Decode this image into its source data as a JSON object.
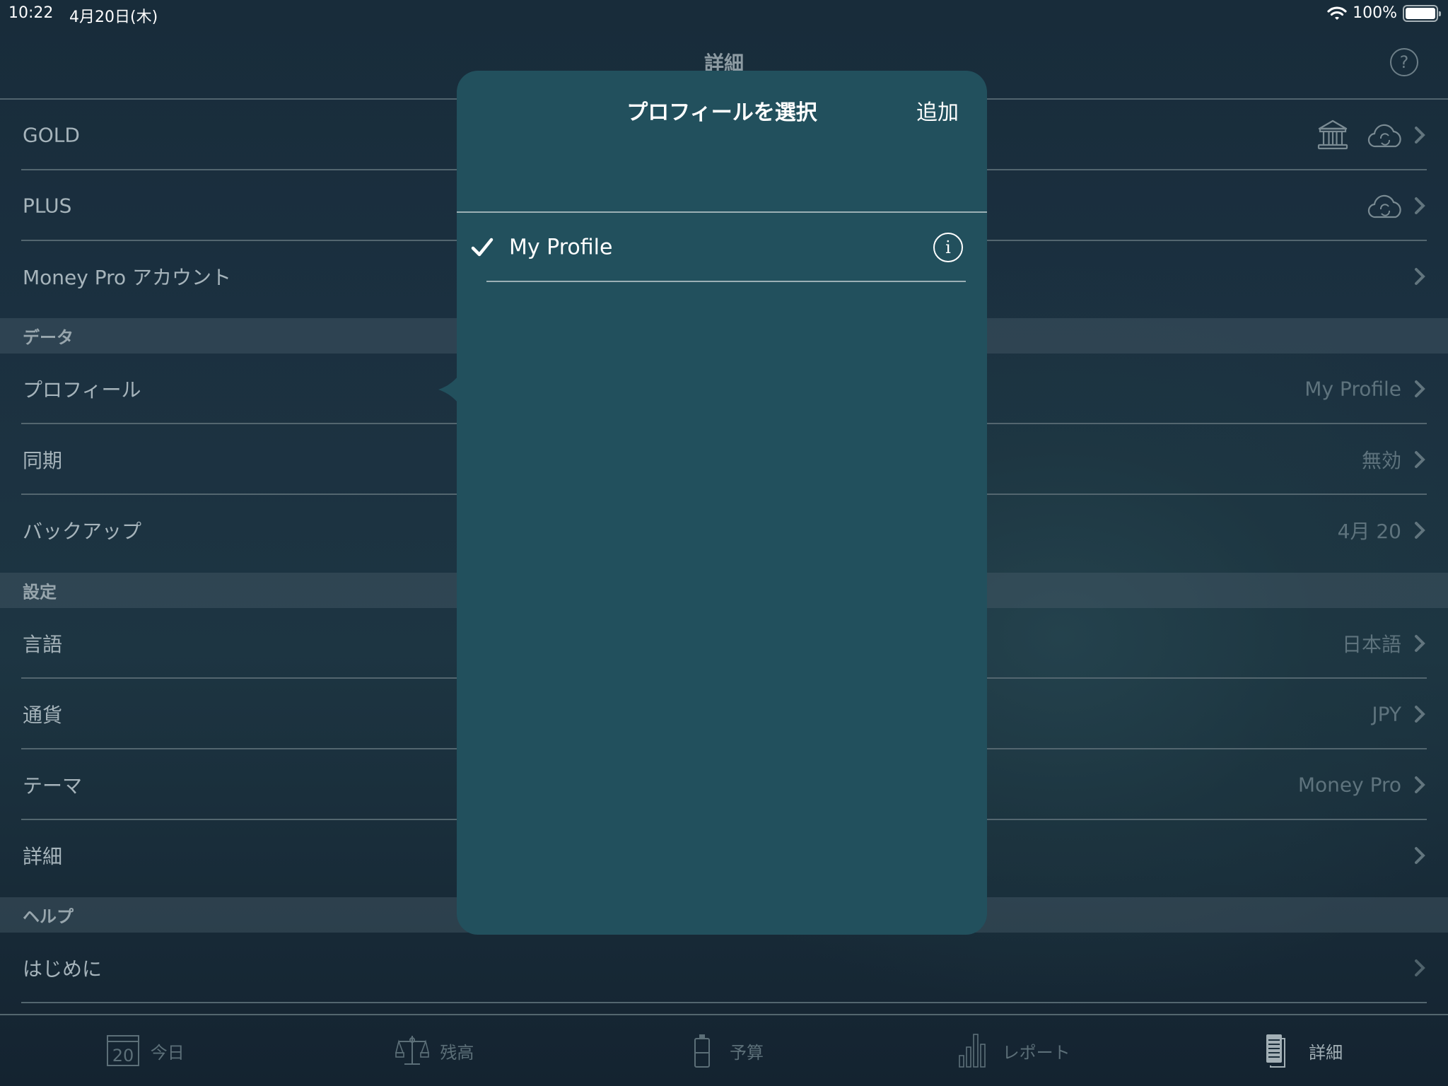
{
  "status_bar": {
    "time": "10:22",
    "date": "4月20日(木)",
    "battery": "100%"
  },
  "nav": {
    "title": "詳細",
    "help_icon": "?"
  },
  "list": {
    "account_rows": [
      {
        "label": "GOLD",
        "icons": [
          "bank-icon",
          "cloud-sync-icon"
        ]
      },
      {
        "label": "PLUS",
        "icons": [
          "cloud-sync-icon"
        ]
      },
      {
        "label": "Money Pro アカウント"
      }
    ],
    "sections": [
      {
        "header": "データ",
        "rows": [
          {
            "label": "プロフィール",
            "value": "My Profile"
          },
          {
            "label": "同期",
            "value": "無効"
          },
          {
            "label": "バックアップ",
            "value": "4月 20"
          }
        ]
      },
      {
        "header": "設定",
        "rows": [
          {
            "label": "言語",
            "value": "日本語"
          },
          {
            "label": "通貨",
            "value": "JPY"
          },
          {
            "label": "テーマ",
            "value": "Money Pro"
          },
          {
            "label": "詳細",
            "value": ""
          }
        ]
      },
      {
        "header": "ヘルプ",
        "rows": [
          {
            "label": "はじめに",
            "value": ""
          }
        ]
      }
    ]
  },
  "popover": {
    "title": "プロフィールを選択",
    "add_label": "追加",
    "profiles": [
      {
        "name": "My Profile",
        "selected": true
      }
    ],
    "info_icon": "i"
  },
  "tab_bar": {
    "tabs": [
      {
        "label": "今日",
        "icon": "calendar-icon",
        "icon_text": "20",
        "active": false
      },
      {
        "label": "残高",
        "icon": "scale-icon",
        "active": false
      },
      {
        "label": "予算",
        "icon": "budget-icon",
        "active": false
      },
      {
        "label": "レポート",
        "icon": "bar-chart-icon",
        "active": false
      },
      {
        "label": "詳細",
        "icon": "document-icon",
        "active": true
      }
    ]
  },
  "colors": {
    "popover_bg": "#22505d",
    "background": "#1b3040",
    "text_muted": "#5e737d"
  }
}
